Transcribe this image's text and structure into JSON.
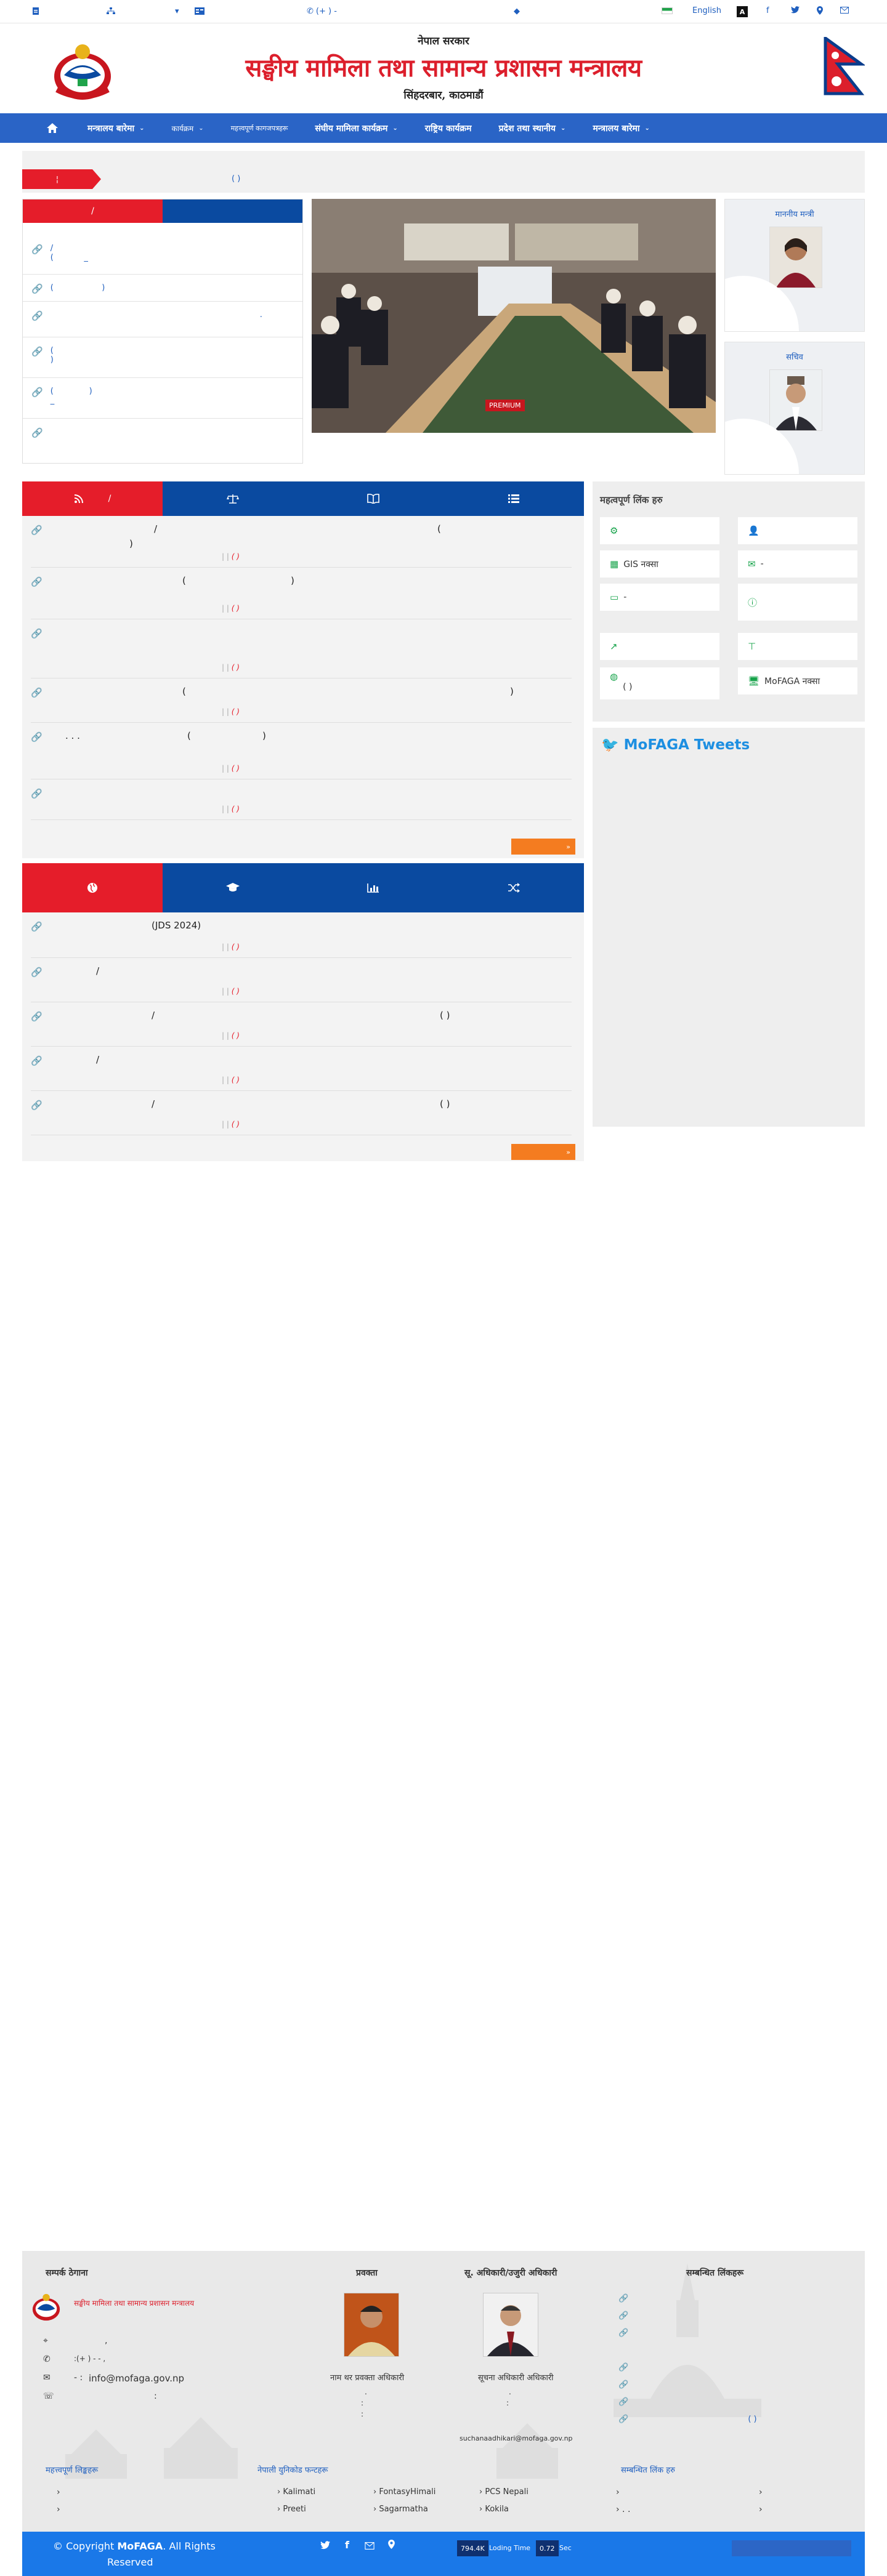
{
  "topbar": {
    "phone": "(+    ) -",
    "language": "English",
    "contrast": "A"
  },
  "header": {
    "gov_line": "नेपाल सरकार",
    "ministry": "सङ्घीय मामिला तथा सामान्य प्रशासन मन्त्रालय",
    "address": "सिंहदरबार, काठमाडौं"
  },
  "nav": {
    "items": [
      "मन्त्रालय बारेमा",
      "कार्यक्रम",
      "महत्त्वपूर्ण कागजपत्रहरू",
      "संघीय मामिला कार्यक्रम",
      "राष्ट्रिय कार्यक्रम",
      "प्रदेश तथा स्थानीय"
    ]
  },
  "notice": {
    "text": "(                                )"
  },
  "left_panel": {
    "tab_left": "/",
    "rows": [
      "/\n(            _",
      "(                   )",
      ".",
      "(\n)",
      "(              )\n_",
      ""
    ]
  },
  "slider": {
    "badge": "PREMIUM"
  },
  "officials": {
    "minister_title": "माननीय मन्त्री",
    "secretary_title": "सचिव"
  },
  "panel1": {
    "rows": [
      {
        "title": "/",
        "tail": "(",
        "date": "( )"
      },
      {
        "title": "(",
        "tail": ")",
        "date": "( )"
      },
      {
        "title": "",
        "tail": "",
        "date": "( )"
      },
      {
        "title": "(",
        "tail": ")",
        "date": "( )"
      },
      {
        "title": "(",
        "tail": ")",
        "date": "( )"
      },
      {
        "title": "",
        "tail": "",
        "date": "( )"
      }
    ],
    "more": "»"
  },
  "panel2": {
    "rows": [
      {
        "title": "(JDS 2024)",
        "tail": "",
        "date": "( )"
      },
      {
        "title": "/",
        "tail": "",
        "date": "( )"
      },
      {
        "title": "/",
        "tail": "(            )",
        "date": "( )"
      },
      {
        "title": "/",
        "tail": "",
        "date": "( )"
      },
      {
        "title": "/",
        "tail": "(                  )",
        "date": "( )"
      }
    ],
    "more": "»"
  },
  "quick_links": {
    "title": "महत्वपूर्ण लिंक हरु",
    "items": [
      "",
      "",
      "GIS नक्सा",
      "-",
      "-",
      "",
      "",
      "",
      "(              )",
      "MoFAGA नक्सा"
    ]
  },
  "tweets": {
    "title": "MoFAGA Tweets"
  },
  "footer": {
    "contact_title": "सम्पर्क ठेगाना",
    "org_name": "सङ्घीय मामिला तथा सामान्य प्रशासन मन्त्रालय",
    "address": ",",
    "phone": ":(+        ) -         -                   ,",
    "email": "info@mofaga.gov.np",
    "info_officer_title": "प्रवक्ता",
    "info_officer_name": "नाम थर प्रवक्ता अधिकारी",
    "pub_officer_title": "सू. अधिकारी/उजुरी अधिकारी",
    "pub_officer_name": "सूचना अधिकारी अधिकारी",
    "pub_officer_email": "suchanaadhikari@mofaga.gov.np",
    "related_title": "सम्बन्धित लिंकहरू",
    "related_links": [
      "",
      "",
      "",
      "",
      "",
      "",
      "( )"
    ],
    "fonts_title": "नेपाली युनिकोड फन्टहरू",
    "fonts": [
      "Kalimati",
      "FontasyHimali",
      "PCS Nepali",
      "Preeti",
      "Sagarmatha",
      "Kokila"
    ],
    "left_links_title": "महत्त्वपूर्ण लिङ्कहरू",
    "right_links_title": "सम्बन्धित लिंक हरु"
  },
  "bottom": {
    "copyright_prefix": "© Copyright",
    "brand": "MoFAGA",
    "copyright_suffix": ". All Rights",
    "reserved": "Reserved",
    "visitor_count": "794.4K",
    "loading_label": "Loding Time",
    "loading_time": "0.72",
    "loading_unit": "Sec"
  }
}
